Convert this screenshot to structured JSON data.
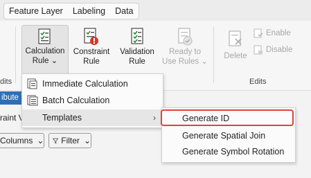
{
  "tabs": [
    "Feature Layer",
    "Labeling",
    "Data"
  ],
  "ribbon": {
    "calculation_rule": [
      "Calculation",
      "Rule"
    ],
    "constraint_rule": [
      "Constraint",
      "Rule"
    ],
    "validation_rule": [
      "Validation",
      "Rule"
    ],
    "ready_to_use": [
      "Ready to",
      "Use Rules"
    ],
    "delete": "Delete",
    "enable": "Enable",
    "disable": "Disable",
    "edits_group_left": "dits",
    "edits_group": "Edits"
  },
  "panel": {
    "title_fragment": "ibute T",
    "subrow_fragment": "raint  V",
    "columns_label": "Columns",
    "filter_label": "Filter"
  },
  "menu": {
    "items": [
      {
        "label": "Immediate Calculation",
        "icon": "immediate-calculation-icon"
      },
      {
        "label": "Batch Calculation",
        "icon": "batch-calculation-icon"
      },
      {
        "label": "Templates",
        "icon": "chevron-right-icon"
      }
    ]
  },
  "submenu": {
    "items": [
      "Generate ID",
      "Generate Spatial Join",
      "Generate Symbol Rotation"
    ]
  },
  "colors": {
    "highlight": "#e0413b",
    "accent_bar": "#2e6eb5"
  }
}
